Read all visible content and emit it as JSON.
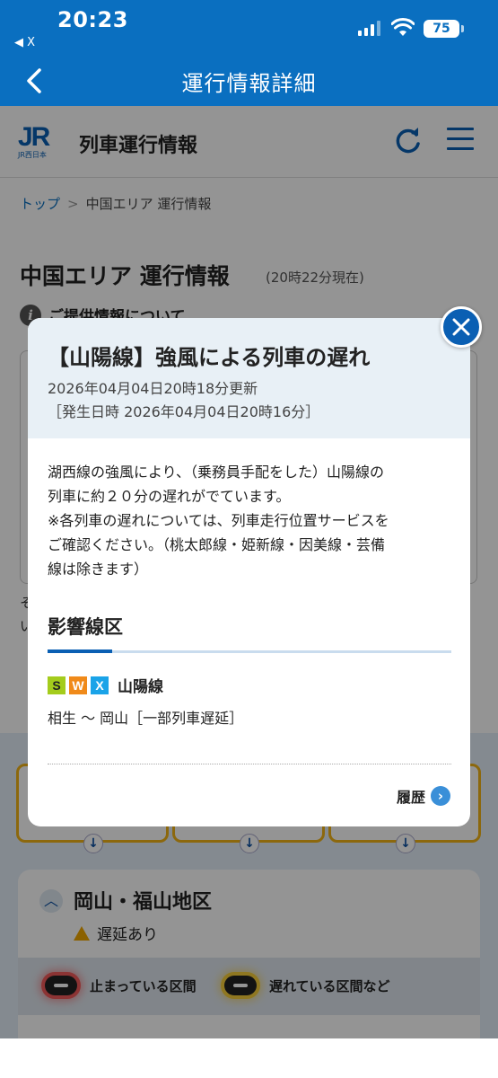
{
  "status_bar": {
    "time": "20:23",
    "back_app": "◀ X",
    "battery": "75"
  },
  "app_header": {
    "title": "運行情報詳細"
  },
  "site_header": {
    "logo_text": "JR",
    "logo_sub": "JR西日本",
    "title": "列車運行情報"
  },
  "breadcrumb": {
    "items": [
      "トップ",
      "中国エリア 運行情報"
    ]
  },
  "page": {
    "title": "中国エリア 運行情報",
    "as_of": "(20時22分現在)",
    "info_link": "ご提供情報について",
    "cut_text_1": "そ",
    "cut_text_2": "い"
  },
  "region": {
    "title": "岡山・福山地区",
    "status": "遅延あり"
  },
  "legend": {
    "stopped": "止まっている区間",
    "delayed": "遅れている区間など"
  },
  "modal": {
    "title": "【山陽線】強風による列車の遅れ",
    "updated": "2026年04月04日20時18分更新",
    "occurred": "［発生日時 2026年04月04日20時16分］",
    "body_lines": [
      "湖西線の強風により、（乗務員手配をした）山陽線の",
      "列車に約２０分の遅れがでています。",
      "※各列車の遅れについては、列車走行位置サービスを",
      "ご確認ください。（桃太郎線・姫新線・因美線・芸備",
      "線は除きます）"
    ],
    "affected_heading": "影響線区",
    "line_badges": [
      "S",
      "W",
      "X"
    ],
    "line_name": "山陽線",
    "section": "相生 〜 岡山［一部列車遅延］",
    "history": "履歴"
  },
  "colors": {
    "brand_blue": "#0a6fc0",
    "badge_s": "#a4cc1c",
    "badge_w": "#f08a1a",
    "badge_x": "#1aa3e8",
    "delay_yellow": "#f2b418"
  }
}
